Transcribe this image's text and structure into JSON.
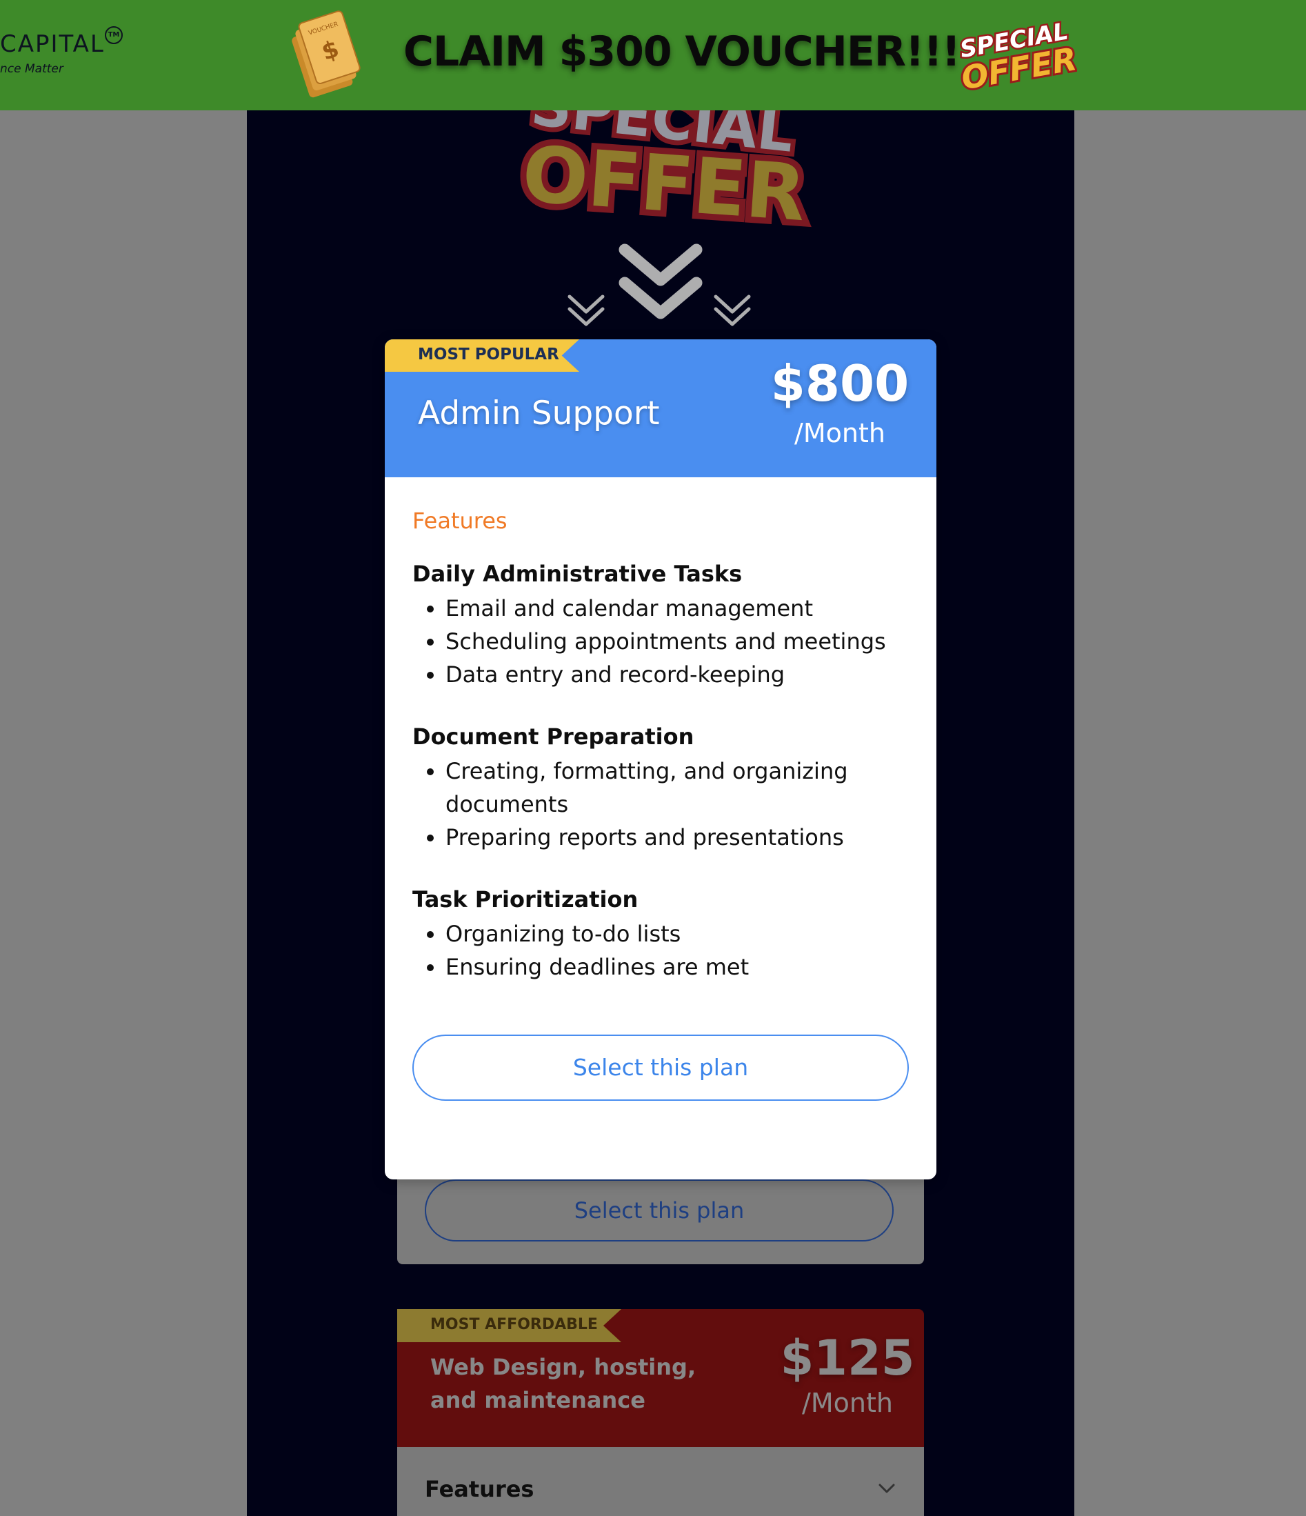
{
  "banner": {
    "logo_text": "CAPITAL",
    "logo_mark": "TM",
    "logo_tagline": "nce Matter",
    "voucher_icon": "voucher-tickets-icon",
    "voucher_label": "VOUCHER",
    "claim_text": "CLAIM $300 VOUCHER!!!",
    "badge_line1": "SPECIAL",
    "badge_line2": "OFFER"
  },
  "hero": {
    "line1": "SPECIAL",
    "line2": "OFFER",
    "arrow_icon": "double-chevron-down-icon"
  },
  "modal": {
    "ribbon": "MOST POPULAR",
    "title": "Admin Support",
    "price": "$800",
    "per": "/Month",
    "features_label": "Features",
    "groups": [
      {
        "title": "Daily Administrative Tasks",
        "items": [
          "Email and calendar management",
          "Scheduling appointments and meetings",
          "Data entry and record-keeping"
        ]
      },
      {
        "title": "Document Preparation",
        "items": [
          "Creating, formatting, and organizing documents",
          "Preparing reports and presentations"
        ]
      },
      {
        "title": "Task Prioritization",
        "items": [
          "Organizing to-do lists",
          "Ensuring deadlines are met"
        ]
      }
    ],
    "select_label": "Select this plan"
  },
  "bg_card_1": {
    "select_label": "Select this plan"
  },
  "bg_card_2": {
    "ribbon": "MOST AFFORDABLE",
    "title": "Web Design, hosting, and maintenance",
    "price": "$125",
    "per": "/Month",
    "features_label": "Features",
    "chevron_icon": "chevron-down-icon"
  },
  "colors": {
    "banner_green": "#3e8a29",
    "modal_header_blue": "#4a8ef0",
    "ribbon_yellow": "#f5c842",
    "features_orange": "#f07a26",
    "dark_background": "#010217"
  }
}
